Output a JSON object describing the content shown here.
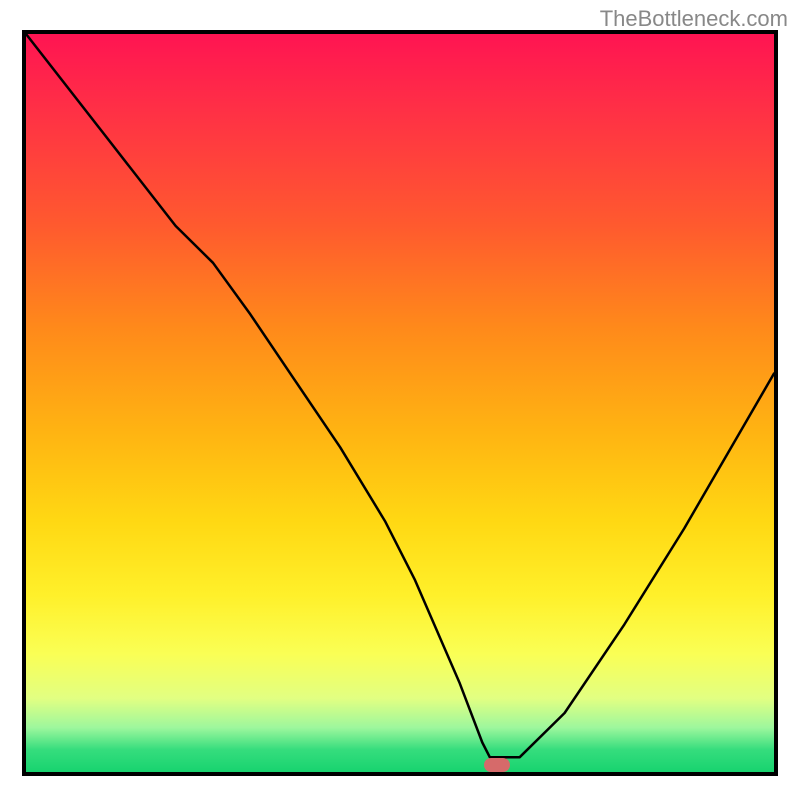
{
  "watermark": "TheBottleneck.com",
  "colors": {
    "border": "#000000",
    "curve": "#000000",
    "marker": "#d66a6a",
    "gradient_top": "#ff1452",
    "gradient_bottom": "#18d36f"
  },
  "chart_data": {
    "type": "line",
    "title": "",
    "xlabel": "",
    "ylabel": "",
    "x_range": [
      0,
      100
    ],
    "y_range": [
      0,
      100
    ],
    "note": "Axes are unlabeled; values are normalized 0–100 on both axes, estimated from pixel positions.",
    "series": [
      {
        "name": "curve",
        "x": [
          0,
          10,
          20,
          25,
          30,
          36,
          42,
          48,
          52,
          55,
          58,
          61,
          62,
          66,
          72,
          80,
          88,
          96,
          100
        ],
        "y": [
          100,
          87,
          74,
          69,
          62,
          53,
          44,
          34,
          26,
          19,
          12,
          4,
          2,
          2,
          8,
          20,
          33,
          47,
          54
        ]
      }
    ],
    "marker": {
      "x": 63,
      "y": 1
    },
    "gradient_stops": [
      {
        "pos": 0.0,
        "color": "#ff1452"
      },
      {
        "pos": 0.1,
        "color": "#ff2f46"
      },
      {
        "pos": 0.26,
        "color": "#ff5a2e"
      },
      {
        "pos": 0.4,
        "color": "#ff8a1a"
      },
      {
        "pos": 0.54,
        "color": "#ffb412"
      },
      {
        "pos": 0.66,
        "color": "#ffd813"
      },
      {
        "pos": 0.76,
        "color": "#fff02a"
      },
      {
        "pos": 0.84,
        "color": "#faff55"
      },
      {
        "pos": 0.9,
        "color": "#e2ff82"
      },
      {
        "pos": 0.94,
        "color": "#9df79d"
      },
      {
        "pos": 0.97,
        "color": "#35dd7d"
      },
      {
        "pos": 1.0,
        "color": "#18d36f"
      }
    ]
  }
}
